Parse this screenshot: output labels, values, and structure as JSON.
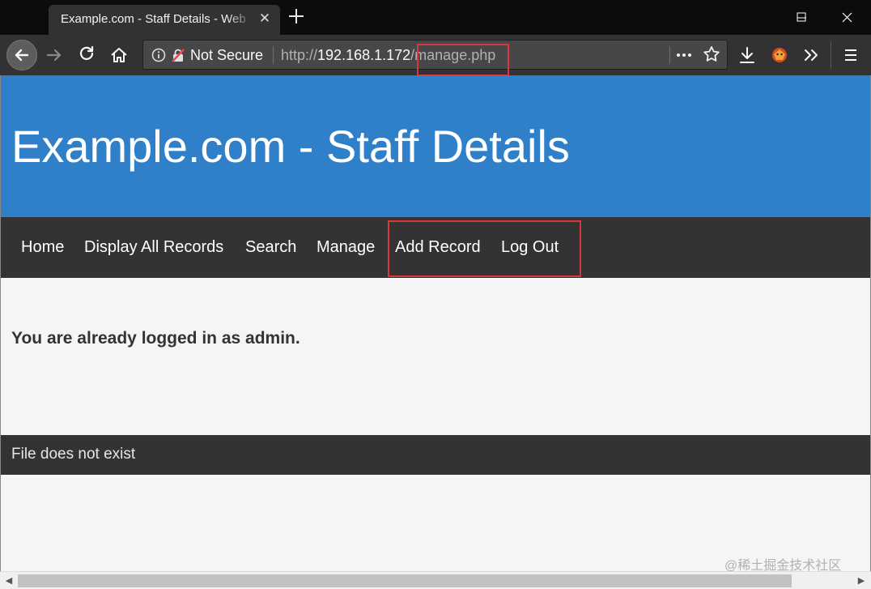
{
  "browser": {
    "tab_title": "Example.com - Staff Details - Web",
    "tab_close_glyph": "✕",
    "new_tab_glyph": "+",
    "security_label": "Not Secure",
    "url_scheme": "http://",
    "url_host": "192.168.1.172",
    "url_path": "/manage.php",
    "icons": [
      "back-icon",
      "forward-icon",
      "reload-icon",
      "home-icon",
      "info-icon",
      "insecure-lock-icon",
      "page-actions-icon",
      "bookmark-star-icon",
      "download-icon",
      "extension-icon",
      "overflow-icon",
      "menu-icon",
      "minimize-icon",
      "maximize-icon",
      "close-icon"
    ]
  },
  "site": {
    "title": "Example.com - Staff Details",
    "nav": {
      "home": "Home",
      "display_all": "Display All Records",
      "search": "Search",
      "manage": "Manage",
      "add_record": "Add Record",
      "log_out": "Log Out"
    },
    "message": "You are already logged in as admin.",
    "footer": "File does not exist"
  },
  "watermark": "@稀土掘金技术社区",
  "colors": {
    "header_blue": "#2f80c8",
    "nav_dark": "#333333",
    "highlight_red": "#d9373b",
    "page_bg": "#f5f5f5"
  }
}
